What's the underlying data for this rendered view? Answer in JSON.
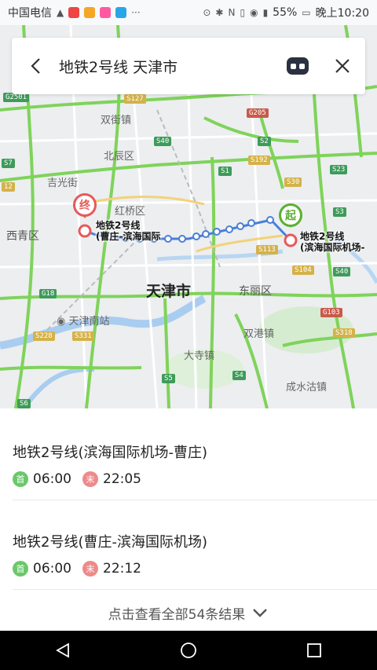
{
  "status_bar": {
    "carrier": "中国电信",
    "battery": "55%",
    "time": "晚上10:20",
    "icons": [
      "hd-icon",
      "app-icon-red",
      "app-icon-yellow",
      "app-icon-pink",
      "app-icon-blue",
      "more-dots-icon",
      "location-icon",
      "bluetooth-icon",
      "nfc-icon",
      "vibrate-icon",
      "eye-icon",
      "signal-icon",
      "battery-icon"
    ]
  },
  "search": {
    "query": "地铁2号线 天津市",
    "back_icon": "chevron-left-icon",
    "robot_icon": "robot-icon",
    "close_icon": "close-icon"
  },
  "map": {
    "city_label": "天津市",
    "district_labels": [
      "北辰区",
      "红桥区",
      "西青区",
      "东丽区",
      "双街镇",
      "吉光街",
      "双港镇",
      "大寺镇",
      "成水沽镇"
    ],
    "poi_label": "天津南站",
    "road_badges": [
      "G2501",
      "S127",
      "S40",
      "G205",
      "S2",
      "S192",
      "S1",
      "S30",
      "S7",
      "S23",
      "S3",
      "S113",
      "S104",
      "S40",
      "G18",
      "G103",
      "S228",
      "S331",
      "S5",
      "S4",
      "S318",
      "S6",
      "12"
    ],
    "end_marker": {
      "label": "终",
      "station_line1": "地铁2号线",
      "station_line2": "(曹庄-滨海国际"
    },
    "start_marker": {
      "label": "起",
      "station_line1": "地铁2号线",
      "station_line2": "(滨海国际机场-"
    },
    "colors": {
      "route": "#4a7fd8",
      "highway": "#7fd35a",
      "end": "#e55a5a",
      "start": "#5ab030"
    }
  },
  "results": [
    {
      "title": "地铁2号线(滨海国际机场-曹庄)",
      "first_badge": "首",
      "first_time": "06:00",
      "last_badge": "末",
      "last_time": "22:05"
    },
    {
      "title": "地铁2号线(曹庄-滨海国际机场)",
      "first_badge": "首",
      "first_time": "06:00",
      "last_badge": "末",
      "last_time": "22:12"
    }
  ],
  "more": {
    "label": "点击查看全部54条结果",
    "icon": "chevron-down-icon"
  },
  "nav": {
    "icons": [
      "back-triangle-icon",
      "home-circle-icon",
      "recents-square-icon"
    ]
  }
}
